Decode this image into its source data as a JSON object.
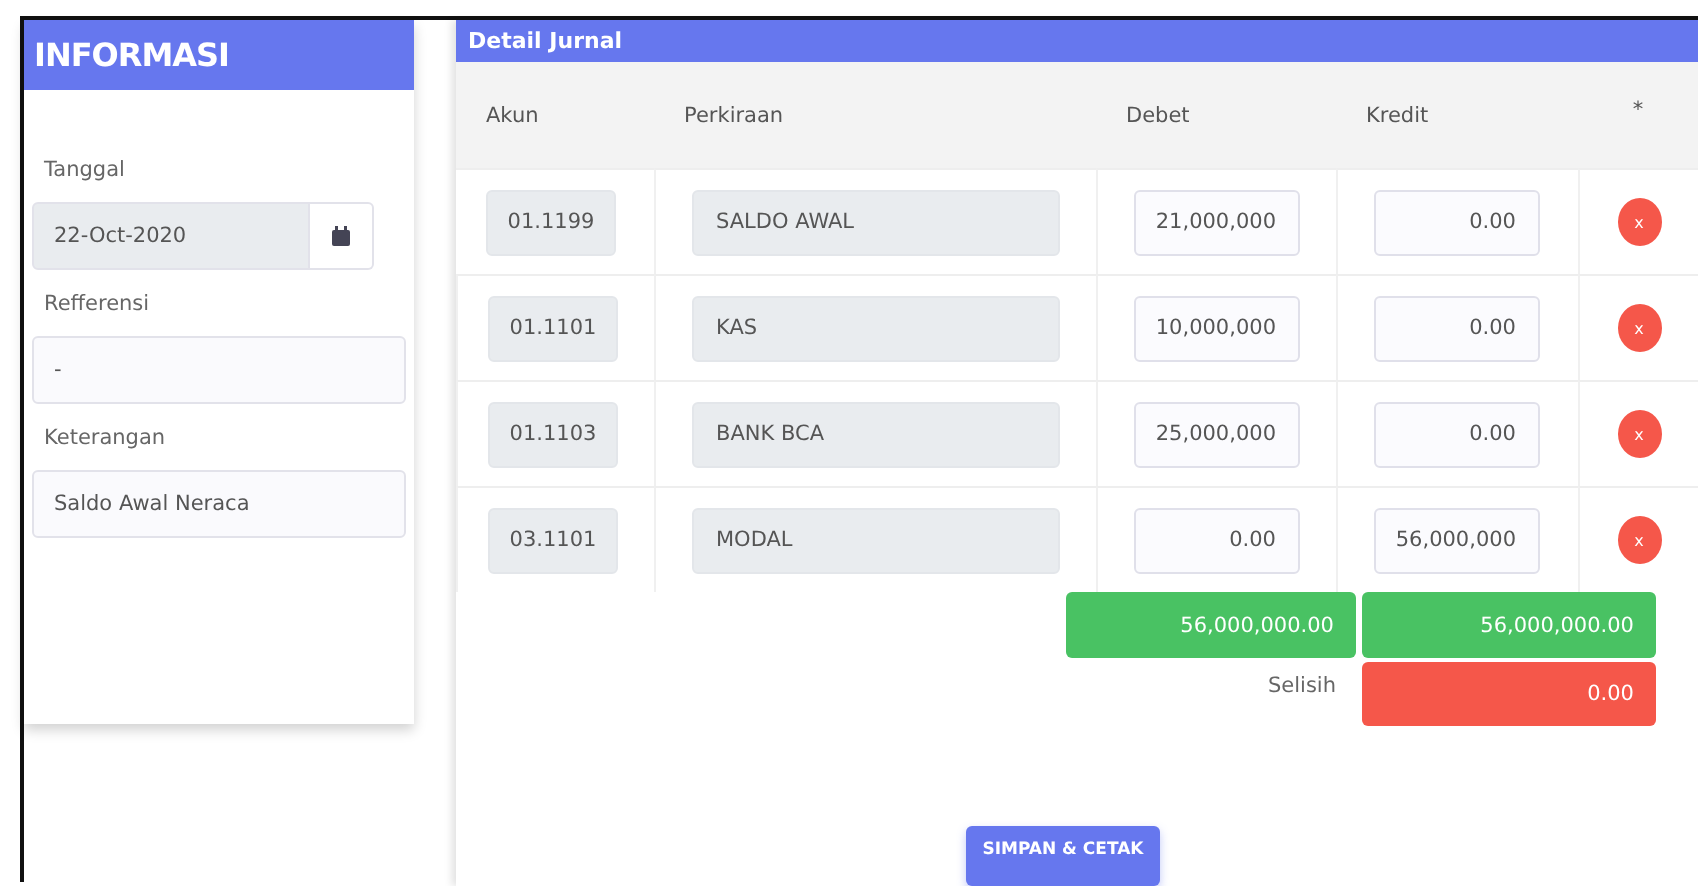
{
  "info": {
    "title": "INFORMASI",
    "fields": [
      {
        "label": "Tanggal",
        "value": "22-Oct-2020",
        "kind": "date"
      },
      {
        "label": "Refferensi",
        "value": "-",
        "kind": "text"
      },
      {
        "label": "Keterangan",
        "value": "Saldo Awal Neraca",
        "kind": "text"
      }
    ]
  },
  "journal": {
    "title": "Detail Jurnal",
    "columns": [
      "Akun",
      "Perkiraan",
      "Debet",
      "Kredit",
      "*"
    ],
    "rows": [
      {
        "account": "01.1199",
        "name": "SALDO AWAL",
        "debit": "21,000,000",
        "credit": "0.00",
        "delete": "x"
      },
      {
        "account": "01.1101",
        "name": "KAS",
        "debit": "10,000,000",
        "credit": "0.00",
        "delete": "x"
      },
      {
        "account": "01.1103",
        "name": "BANK BCA",
        "debit": "25,000,000",
        "credit": "0.00",
        "delete": "x"
      },
      {
        "account": "03.1101",
        "name": "MODAL",
        "debit": "0.00",
        "credit": "56,000,000",
        "delete": "x"
      }
    ],
    "totals": {
      "debit": "56,000,000.00",
      "credit": "56,000,000.00",
      "difference_label": "Selisih",
      "difference": "0.00"
    },
    "save_button": "SIMPAN & CETAK"
  }
}
